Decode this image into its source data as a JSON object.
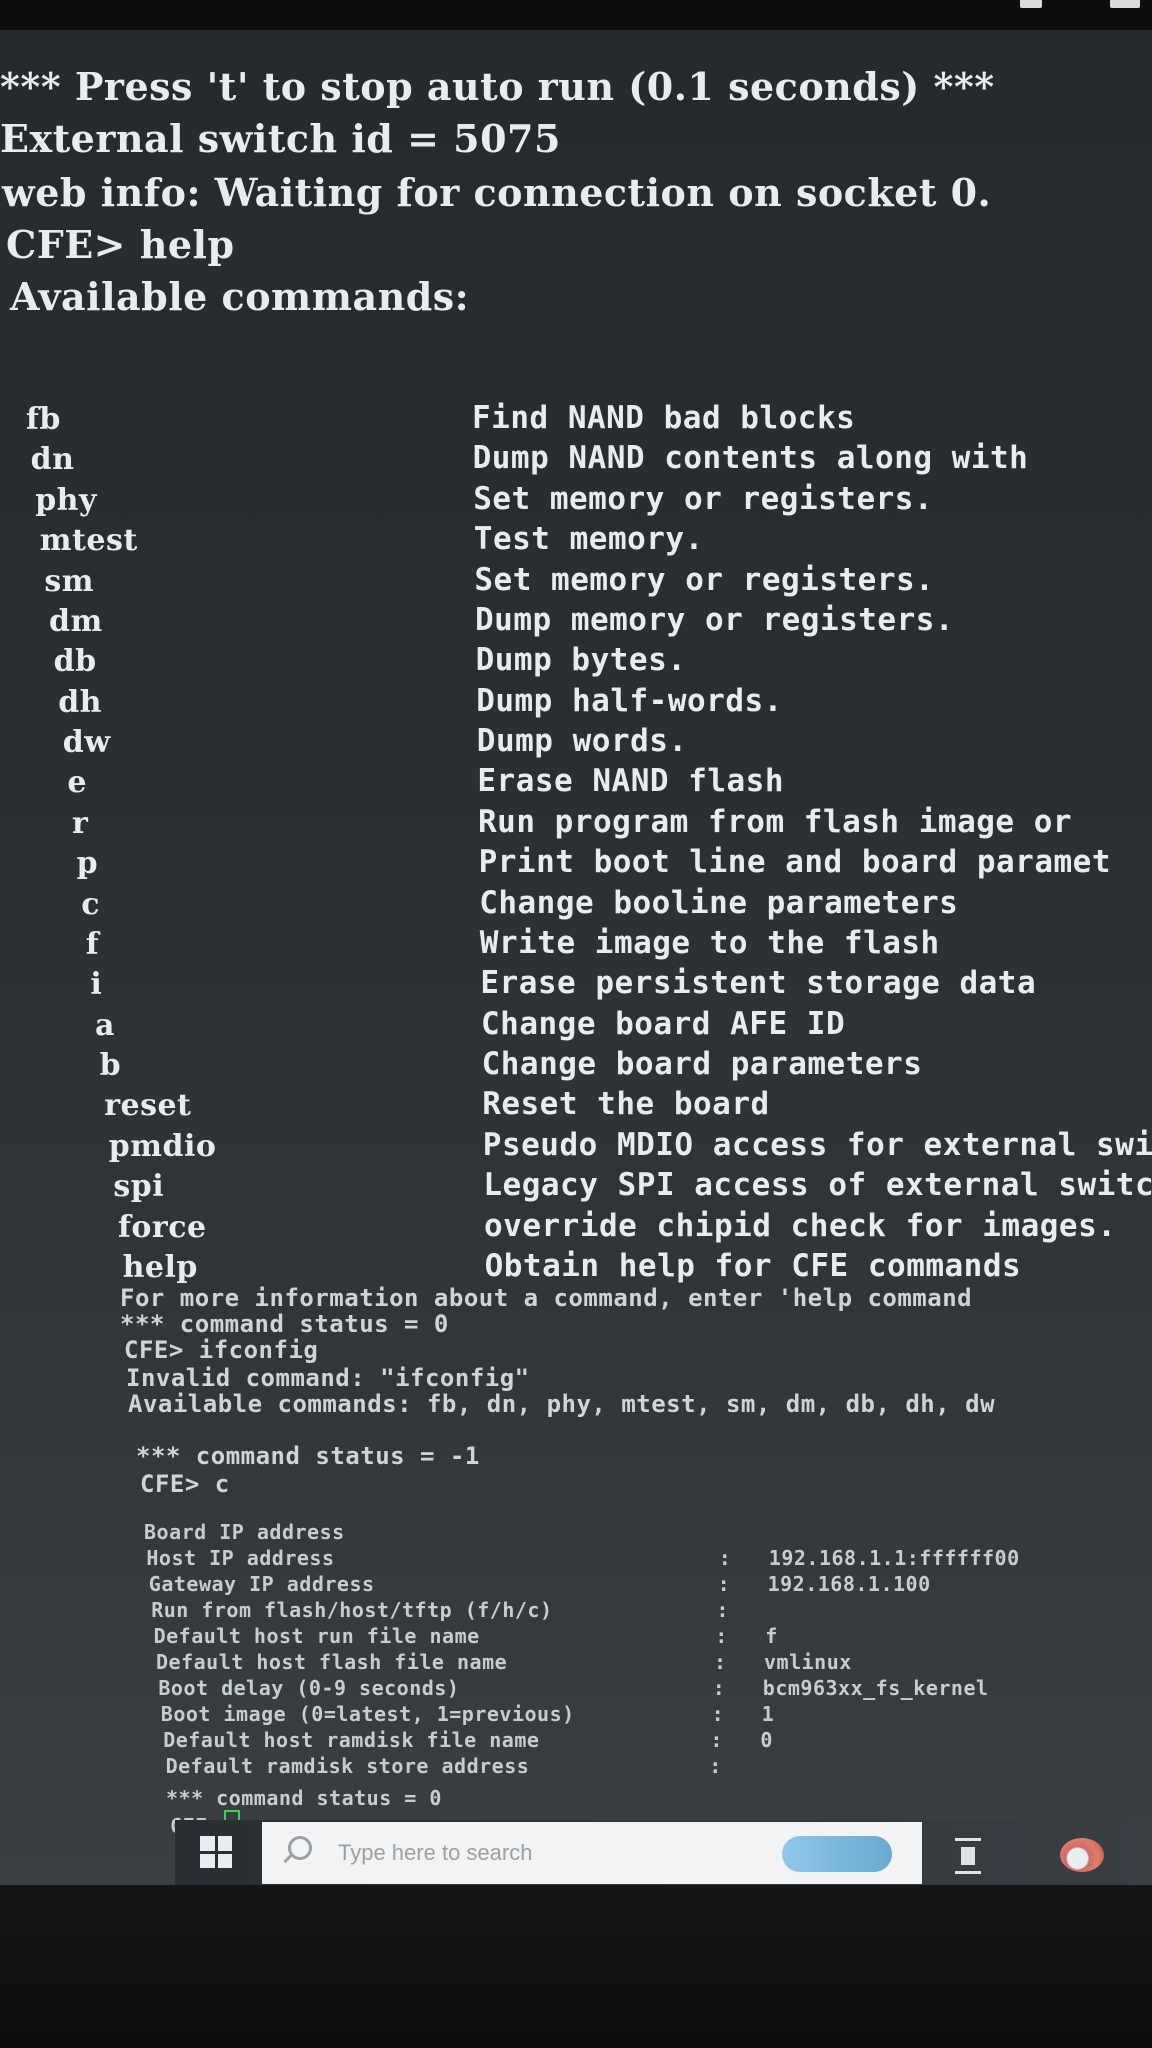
{
  "banner": {
    "autorun": "*** Press 't' to stop auto run (0.1 seconds) ***",
    "switch_id": "External switch id = 5075",
    "web_info": "web info: Waiting for connection on socket 0."
  },
  "prompt_help": "CFE> help",
  "available_header": "Available commands:",
  "commands": [
    {
      "name": "fb",
      "desc": "Find NAND bad blocks"
    },
    {
      "name": "dn",
      "desc": "Dump NAND contents along with"
    },
    {
      "name": "phy",
      "desc": "Set memory or registers."
    },
    {
      "name": "mtest",
      "desc": "Test memory."
    },
    {
      "name": "sm",
      "desc": "Set memory or registers."
    },
    {
      "name": "dm",
      "desc": "Dump memory or registers."
    },
    {
      "name": "db",
      "desc": "Dump bytes."
    },
    {
      "name": "dh",
      "desc": "Dump half-words."
    },
    {
      "name": "dw",
      "desc": "Dump words."
    },
    {
      "name": "e",
      "desc": "Erase NAND flash"
    },
    {
      "name": "r",
      "desc": "Run program from flash image or"
    },
    {
      "name": "p",
      "desc": "Print boot line and board paramet"
    },
    {
      "name": "c",
      "desc": "Change booline parameters"
    },
    {
      "name": "f",
      "desc": "Write image to the flash"
    },
    {
      "name": "i",
      "desc": "Erase persistent storage data"
    },
    {
      "name": "a",
      "desc": "Change board AFE ID"
    },
    {
      "name": "b",
      "desc": "Change board parameters"
    },
    {
      "name": "reset",
      "desc": "Reset the board"
    },
    {
      "name": "pmdio",
      "desc": "Pseudo MDIO access for external swi"
    },
    {
      "name": "spi",
      "desc": "Legacy SPI access of external switc"
    },
    {
      "name": "force",
      "desc": "override chipid check for images."
    },
    {
      "name": "help",
      "desc": "Obtain help for CFE commands"
    }
  ],
  "more_info": "For more information about a command, enter 'help command",
  "status_0": "*** command status = 0",
  "prompt_ifconfig": "CFE> ifconfig",
  "invalid_cmd": "Invalid command: \"ifconfig\"",
  "available_list": "Available commands: fb, dn, phy, mtest, sm, dm, db, dh, dw",
  "status_neg1": "*** command status = -1",
  "prompt_c": "CFE> c",
  "params": [
    {
      "label": "Board IP address",
      "sep": "",
      "value": ""
    },
    {
      "label": "Host IP address",
      "sep": ":",
      "value": "192.168.1.1:ffffff00"
    },
    {
      "label": "Gateway IP address",
      "sep": ":",
      "value": "192.168.1.100"
    },
    {
      "label": "Run from flash/host/tftp (f/h/c)",
      "sep": ":",
      "value": ""
    },
    {
      "label": "Default host run file name",
      "sep": ":",
      "value": "f"
    },
    {
      "label": "Default host flash file name",
      "sep": ":",
      "value": "vmlinux"
    },
    {
      "label": "Boot delay (0-9 seconds)",
      "sep": ":",
      "value": "bcm963xx_fs_kernel"
    },
    {
      "label": "Boot image (0=latest, 1=previous)",
      "sep": ":",
      "value": "1"
    },
    {
      "label": "Default host ramdisk file name",
      "sep": ":",
      "value": "0"
    },
    {
      "label": "Default ramdisk store address",
      "sep": ":",
      "value": ""
    }
  ],
  "status_0b": "*** command status = 0",
  "prompt_final": "CFE>",
  "taskbar": {
    "search_placeholder": "Type here to search"
  },
  "colors": {
    "cursor": "#37d34a",
    "text": "#e8ecee",
    "background": "#2a2f31"
  }
}
